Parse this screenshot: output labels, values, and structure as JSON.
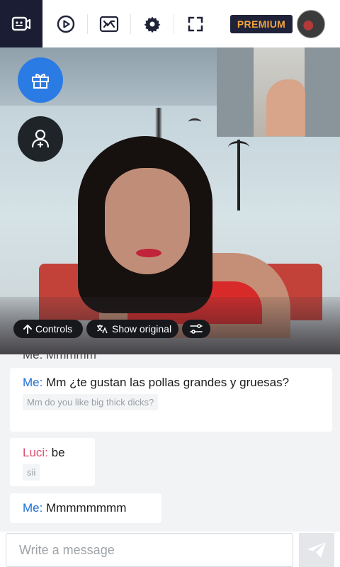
{
  "toolbar": {
    "premium_label": "PREMIUM"
  },
  "video_controls": {
    "controls_label": "Controls",
    "show_original_label": "Show original"
  },
  "chat": {
    "partial_message": "Me: Mmmmm",
    "messages": [
      {
        "sender": "Me:",
        "text": "Mm ¿te gustan las pollas grandes y gruesas?",
        "translation": "Mm do you like big thick dicks?"
      },
      {
        "sender": "Luci:",
        "text": "be",
        "translation": "sii"
      },
      {
        "sender": "Me:",
        "text": "Mmmmmmmm"
      }
    ]
  },
  "composer": {
    "placeholder": "Write a message"
  },
  "colors": {
    "active_tab": "#1a1d33",
    "premium_text": "#f2a43a",
    "me_name": "#1f6fd6",
    "luci_name": "#e0506e",
    "gift_button": "#2b7be4"
  },
  "icons": [
    "camera-chat-icon",
    "play-icon",
    "shuffle-icon",
    "gear-icon",
    "fullscreen-icon",
    "gift-icon",
    "add-user-icon",
    "arrow-up-icon",
    "translate-icon",
    "sliders-icon",
    "send-icon"
  ]
}
